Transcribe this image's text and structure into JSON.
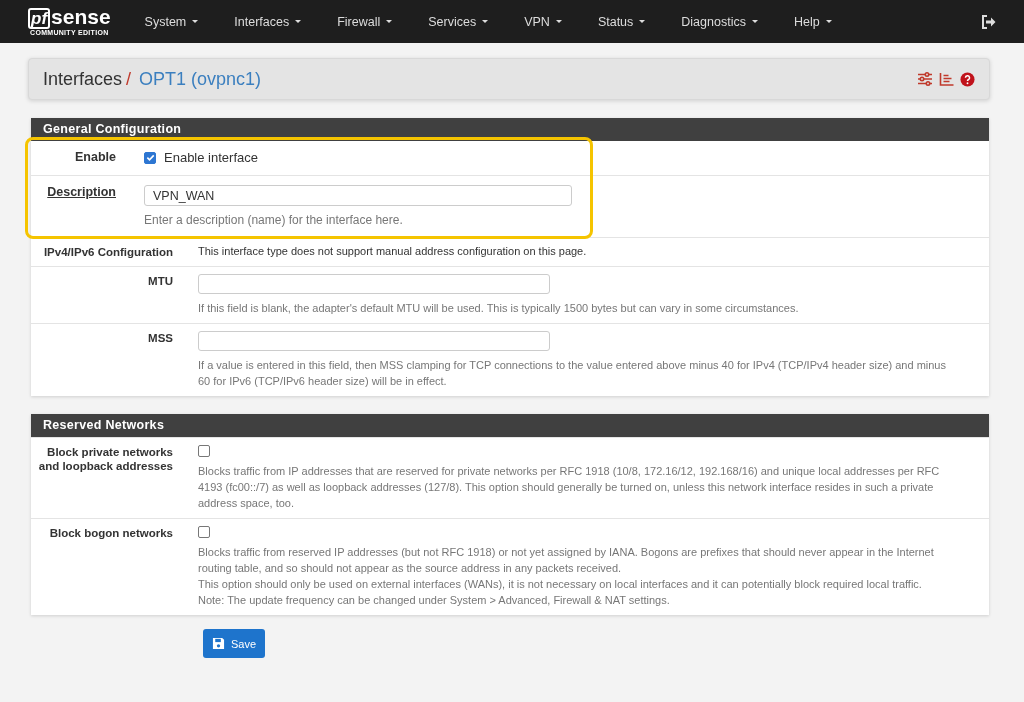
{
  "nav": {
    "logo": {
      "mark": "pf",
      "brand": "sense",
      "edition": "COMMUNITY EDITION"
    },
    "items": [
      {
        "label": "System"
      },
      {
        "label": "Interfaces"
      },
      {
        "label": "Firewall"
      },
      {
        "label": "Services"
      },
      {
        "label": "VPN"
      },
      {
        "label": "Status"
      },
      {
        "label": "Diagnostics"
      },
      {
        "label": "Help"
      }
    ]
  },
  "breadcrumb": {
    "parent": "Interfaces",
    "separator": "/",
    "current": "OPT1 (ovpnc1)"
  },
  "sections": [
    {
      "title": "General Configuration",
      "rows": [
        {
          "kind": "checkbox",
          "label": "Enable",
          "highlighted": true,
          "checked": true,
          "checkbox_label": "Enable interface"
        },
        {
          "kind": "text_input",
          "label": "Description",
          "underlined": true,
          "highlighted": true,
          "value": "VPN_WAN",
          "help": [
            "Enter a description (name) for the interface here."
          ]
        },
        {
          "kind": "static",
          "label": "IPv4/IPv6 Configuration",
          "highlighted": false,
          "text": "This interface type does not support manual address configuration on this page."
        },
        {
          "kind": "text_input",
          "label": "MTU",
          "highlighted": false,
          "help": [
            "If this field is blank, the adapter's default MTU will be used. This is typically 1500 bytes but can vary in some circumstances."
          ]
        },
        {
          "kind": "text_input",
          "label": "MSS",
          "highlighted": false,
          "help": [
            "If a value is entered in this field, then MSS clamping for TCP connections to the value entered above minus 40 for IPv4 (TCP/IPv4 header size) and minus 60 for IPv6 (TCP/IPv6 header size) will be in effect."
          ]
        }
      ]
    },
    {
      "title": "Reserved Networks",
      "rows": [
        {
          "kind": "checkbox",
          "label": "Block private networks and loopback addresses",
          "highlighted": false,
          "checked": false,
          "help": [
            "Blocks traffic from IP addresses that are reserved for private networks per RFC 1918 (10/8, 172.16/12, 192.168/16) and unique local addresses per RFC 4193 (fc00::/7) as well as loopback addresses (127/8). This option should generally be turned on, unless this network interface resides in such a private address space, too."
          ]
        },
        {
          "kind": "checkbox",
          "label": "Block bogon networks",
          "highlighted": false,
          "checked": false,
          "help": [
            "Blocks traffic from reserved IP addresses (but not RFC 1918) or not yet assigned by IANA. Bogons are prefixes that should never appear in the Internet routing table, and so should not appear as the source address in any packets received.",
            "This option should only be used on external interfaces (WANs), it is not necessary on local interfaces and it can potentially block required local traffic.",
            "Note: The update frequency can be changed under System > Advanced, Firewall & NAT settings."
          ]
        }
      ]
    }
  ],
  "save_button": {
    "label": "Save"
  }
}
